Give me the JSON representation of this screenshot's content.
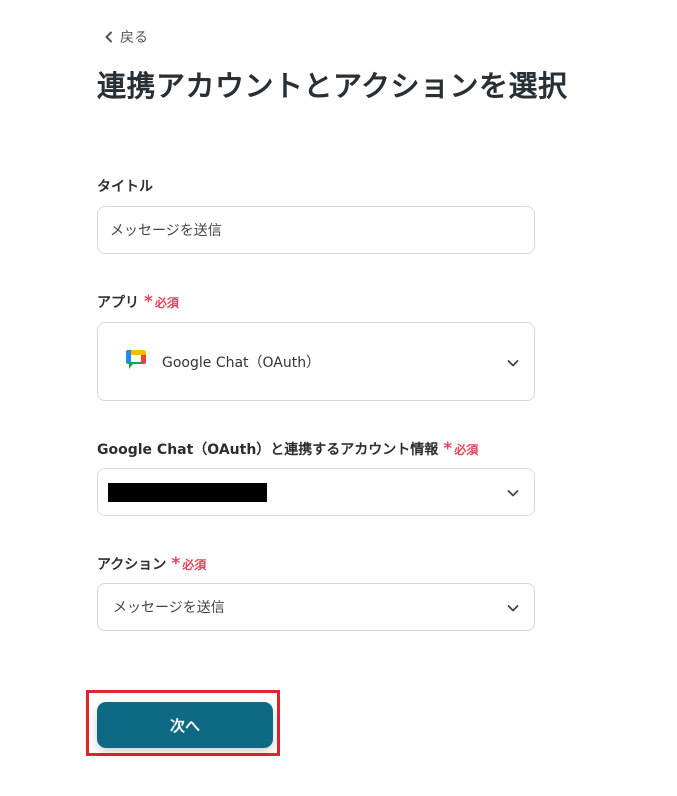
{
  "back": {
    "label": "戻る"
  },
  "page_title": "連携アカウントとアクションを選択",
  "fields": {
    "title": {
      "label": "タイトル",
      "value": "メッセージを送信"
    },
    "app": {
      "label": "アプリ",
      "required_mark": "*",
      "required_text": "必須",
      "value": "Google Chat（OAuth）",
      "icon": "google-chat-logo"
    },
    "account": {
      "label": "Google Chat（OAuth）と連携するアカウント情報",
      "required_mark": "*",
      "required_text": "必須",
      "value_redacted": true
    },
    "action": {
      "label": "アクション",
      "required_mark": "*",
      "required_text": "必須",
      "value": "メッセージを送信"
    }
  },
  "next_button": {
    "label": "次へ"
  },
  "colors": {
    "primary": "#0e6a84",
    "required": "#e3455a",
    "highlight": "#e0242c"
  }
}
